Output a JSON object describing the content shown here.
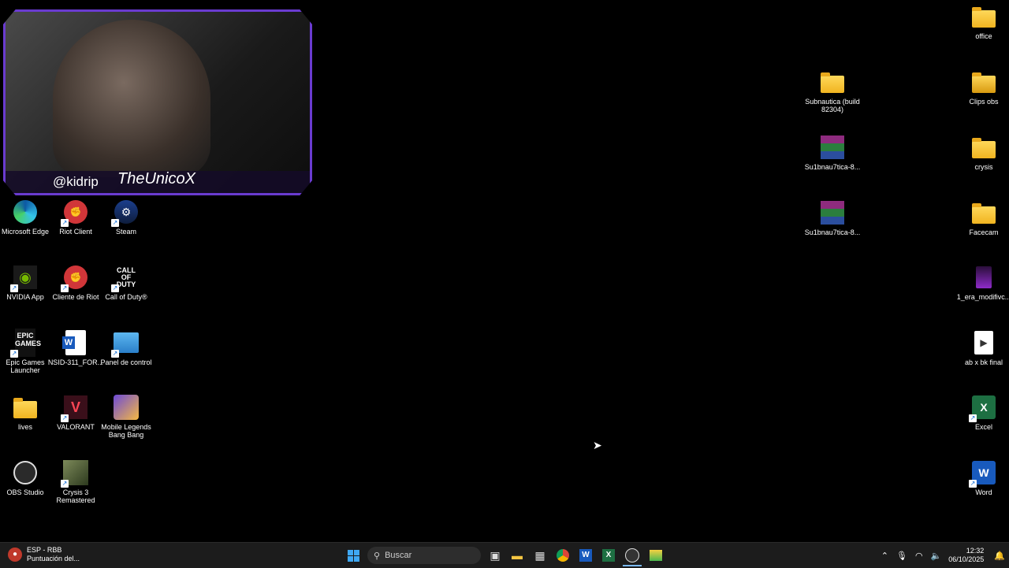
{
  "webcam": {
    "handle": "@kidrip",
    "name": "TheUnicoX"
  },
  "desktop_left": [
    {
      "label": "Microsoft Edge",
      "icon": "edge-icon"
    },
    {
      "label": "Riot Client",
      "icon": "riot-icon"
    },
    {
      "label": "Steam",
      "icon": "steam-icon"
    },
    {
      "label": "NVIDIA App",
      "icon": "nvidia-icon"
    },
    {
      "label": "Cliente de Riot",
      "icon": "riot-icon"
    },
    {
      "label": "Call of Duty®",
      "icon": "cod-icon"
    },
    {
      "label": "Epic Games Launcher",
      "icon": "epic-icon"
    },
    {
      "label": "NSID-311_FOR...",
      "icon": "word-doc-icon"
    },
    {
      "label": "Panel de control",
      "icon": "control-panel-icon"
    },
    {
      "label": "lives",
      "icon": "folder-icon"
    },
    {
      "label": "VALORANT",
      "icon": "valorant-icon"
    },
    {
      "label": "Mobile Legends Bang Bang",
      "icon": "mlbb-icon"
    },
    {
      "label": "OBS Studio",
      "icon": "obs-icon"
    },
    {
      "label": "Crysis 3 Remastered",
      "icon": "crysis-icon"
    }
  ],
  "desktop_right": [
    {
      "label": "office",
      "icon": "folder-icon"
    },
    {
      "label": "Subnautica (build 82304)",
      "icon": "folder-icon"
    },
    {
      "label": "Clips obs",
      "icon": "folder-icon"
    },
    {
      "label": "Su1bnau7tica-8...",
      "icon": "rar-icon"
    },
    {
      "label": "crysis",
      "icon": "folder-icon"
    },
    {
      "label": "Su1bnau7tica-8...",
      "icon": "rar-icon"
    },
    {
      "label": "Facecam",
      "icon": "folder-icon"
    },
    {
      "label": "1_era_modifivc...",
      "icon": "image-file-icon"
    },
    {
      "label": "ab x bk final",
      "icon": "video-file-icon"
    },
    {
      "label": "Excel",
      "icon": "excel-icon"
    },
    {
      "label": "Word",
      "icon": "word-icon"
    }
  ],
  "taskbar": {
    "weather_line1": "ESP - RBB",
    "weather_line2": "Puntuación del...",
    "search_placeholder": "Buscar",
    "time": "12:32",
    "date": "06/10/2025",
    "apps": [
      "task-view-icon",
      "file-explorer-icon",
      "store-icon",
      "chrome-icon",
      "word-icon",
      "excel-icon",
      "obs-icon",
      "bluestacks-icon"
    ]
  }
}
